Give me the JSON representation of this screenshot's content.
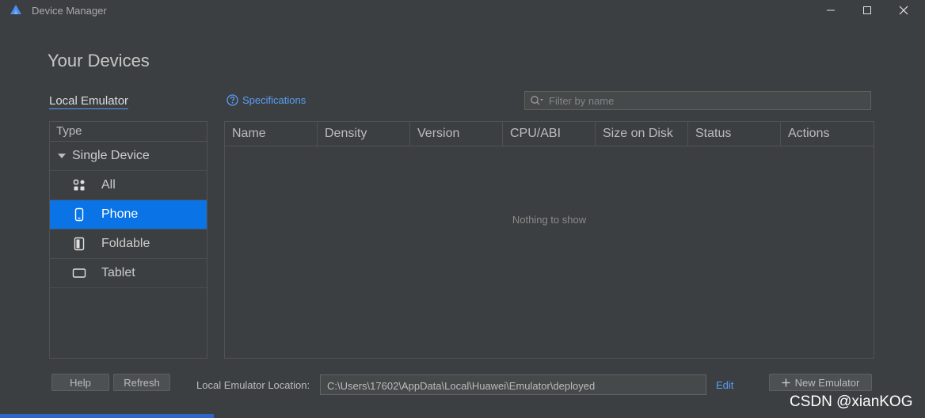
{
  "window": {
    "title": "Device Manager",
    "logo_icon": "huawei-devstudio-logo",
    "controls": [
      "minimize-icon",
      "maximize-icon",
      "close-icon"
    ]
  },
  "page": {
    "title": "Your Devices"
  },
  "tabs": {
    "local_emulator": "Local Emulator"
  },
  "specifications": {
    "label": "Specifications",
    "icon": "question-circle-icon"
  },
  "filter": {
    "placeholder": "Filter by name",
    "value": ""
  },
  "sidebar": {
    "header": "Type",
    "group": "Single Device",
    "items": [
      {
        "label": "All",
        "icon": "grid-apps-icon",
        "selected": false
      },
      {
        "label": "Phone",
        "icon": "phone-icon",
        "selected": true
      },
      {
        "label": "Foldable",
        "icon": "foldable-icon",
        "selected": false
      },
      {
        "label": "Tablet",
        "icon": "tablet-icon",
        "selected": false
      }
    ]
  },
  "table": {
    "columns": [
      "Name",
      "Density",
      "Version",
      "CPU/ABI",
      "Size on Disk",
      "Status",
      "Actions"
    ],
    "rows": [],
    "empty_text": "Nothing to show"
  },
  "footer": {
    "help": "Help",
    "refresh": "Refresh",
    "location_label": "Local Emulator Location:",
    "location_value": "C:\\Users\\17602\\AppData\\Local\\Huawei\\Emulator\\deployed",
    "edit": "Edit",
    "new_emulator": "New Emulator"
  },
  "watermark": "CSDN @xianKOG",
  "colors": {
    "accent": "#589df6",
    "selected": "#0a74e6",
    "background": "#3c3f41"
  }
}
